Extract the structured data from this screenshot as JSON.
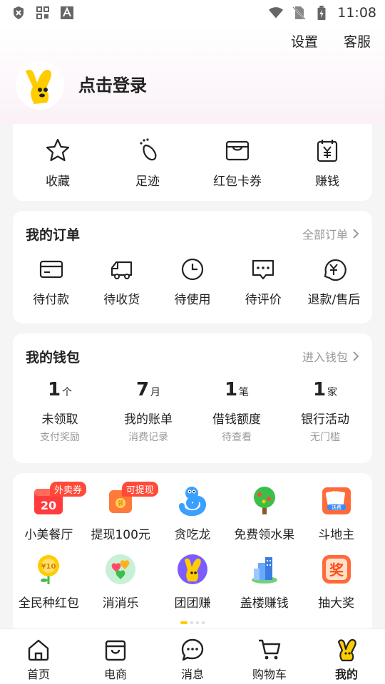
{
  "status_bar": {
    "time": "11:08",
    "icons": [
      "shield-icon",
      "grid-apps-icon",
      "font-a-icon",
      "wifi-icon",
      "no-sim-icon",
      "battery-charging-icon"
    ]
  },
  "header": {
    "settings_label": "设置",
    "service_label": "客服",
    "login_label": "点击登录",
    "avatar_icon": "mascot-icon"
  },
  "quick_actions": [
    {
      "label": "收藏",
      "icon": "star-icon"
    },
    {
      "label": "足迹",
      "icon": "footprint-icon"
    },
    {
      "label": "红包卡券",
      "icon": "wallet-card-icon"
    },
    {
      "label": "赚钱",
      "icon": "yuan-calendar-icon"
    }
  ],
  "orders": {
    "title": "我的订单",
    "link": "全部订单",
    "items": [
      {
        "label": "待付款",
        "icon": "card-icon"
      },
      {
        "label": "待收货",
        "icon": "truck-icon"
      },
      {
        "label": "待使用",
        "icon": "clock-icon"
      },
      {
        "label": "待评价",
        "icon": "comment-icon"
      },
      {
        "label": "退款/售后",
        "icon": "refund-icon"
      }
    ]
  },
  "wallet": {
    "title": "我的钱包",
    "link": "进入钱包",
    "items": [
      {
        "value": "1",
        "unit": "个",
        "label": "未领取",
        "sub": "支付奖励"
      },
      {
        "value": "7",
        "unit": "月",
        "label": "我的账单",
        "sub": "消费记录"
      },
      {
        "value": "1",
        "unit": "笔",
        "label": "借钱额度",
        "sub": "待查看"
      },
      {
        "value": "1",
        "unit": "家",
        "label": "银行活动",
        "sub": "无门槛"
      }
    ]
  },
  "games": [
    {
      "label": "小美餐厅",
      "icon": "restaurant-calendar-icon",
      "badge": "外卖券",
      "badge_text": "20"
    },
    {
      "label": "提现100元",
      "icon": "red-packet-icon",
      "badge": "可提现",
      "badge_text": "领"
    },
    {
      "label": "贪吃龙",
      "icon": "snake-icon",
      "badge": ""
    },
    {
      "label": "免费领水果",
      "icon": "fruit-tree-icon",
      "badge": ""
    },
    {
      "label": "斗地主",
      "icon": "poker-cards-icon",
      "badge": "",
      "badge_text": "话费"
    },
    {
      "label": "全民种红包",
      "icon": "money-flower-icon",
      "badge": "",
      "badge_text": "¥10"
    },
    {
      "label": "消消乐",
      "icon": "match-hearts-icon",
      "badge": ""
    },
    {
      "label": "团团赚",
      "icon": "mascot-game-icon",
      "badge": ""
    },
    {
      "label": "盖楼赚钱",
      "icon": "building-icon",
      "badge": ""
    },
    {
      "label": "抽大奖",
      "icon": "prize-draw-icon",
      "badge": "",
      "badge_text": "奖"
    }
  ],
  "bottom_nav": [
    {
      "label": "首页",
      "icon": "home-icon",
      "active": false
    },
    {
      "label": "电商",
      "icon": "shopping-bag-icon",
      "active": false
    },
    {
      "label": "消息",
      "icon": "message-icon",
      "active": false
    },
    {
      "label": "购物车",
      "icon": "cart-icon",
      "active": false
    },
    {
      "label": "我的",
      "icon": "mascot-me-icon",
      "active": true
    }
  ],
  "colors": {
    "brand_yellow": "#ffcc00",
    "badge_red": "#ff4a3a"
  }
}
